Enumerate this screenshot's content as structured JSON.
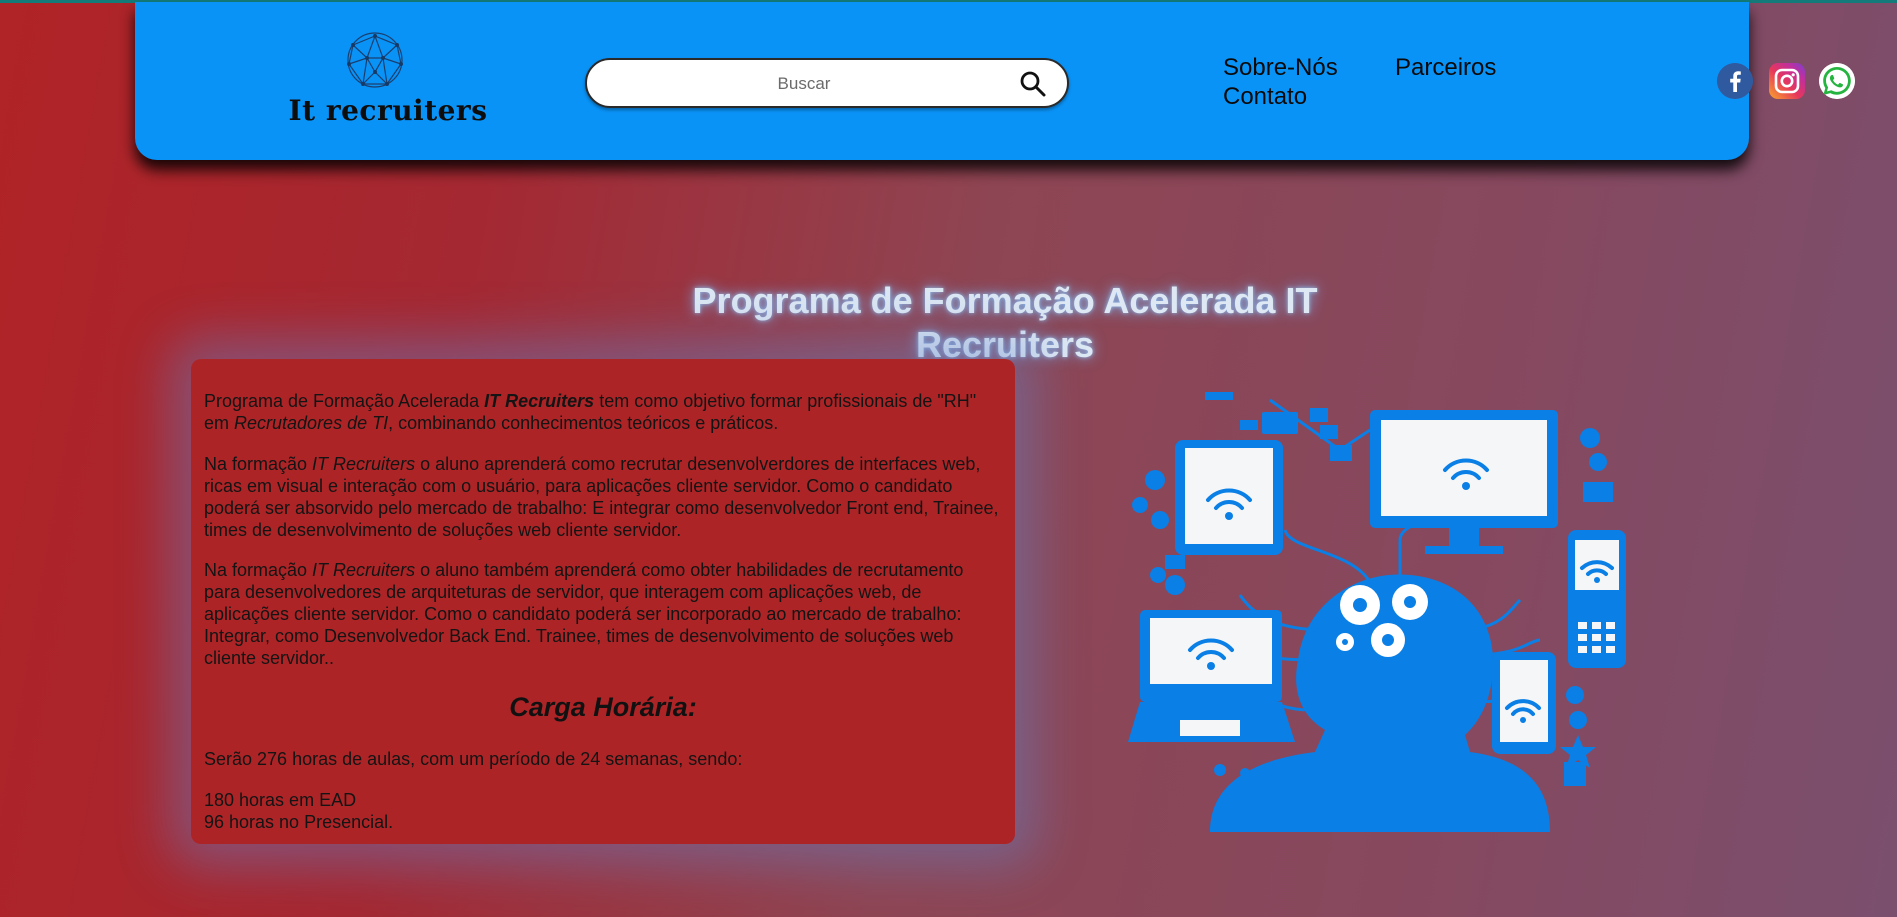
{
  "header": {
    "logo_text": "It recruiters",
    "search": {
      "placeholder": "Buscar"
    },
    "nav": {
      "about": "Sobre-Nós",
      "partners": "Parceiros",
      "contact": "Contato"
    },
    "social": [
      "facebook-icon",
      "instagram-icon",
      "whatsapp-icon"
    ]
  },
  "main": {
    "title": "Programa de Formação Acelerada IT Recruiters",
    "paragraph1": {
      "a": "Programa de Formação Acelerada ",
      "b": "IT Recruiters",
      "c": " tem como objetivo formar profissionais de \"RH\" em ",
      "d": "Recrutadores de TI",
      "e": ", combinando conhecimentos teóricos e práticos."
    },
    "paragraph2": {
      "a": "Na formação ",
      "b": "IT Recruiters",
      "c": " o aluno aprenderá como recrutar desenvolverdores de interfaces web, ricas em visual e interação com o usuário, para aplicações cliente servidor. Como o candidato poderá ser absorvido pelo mercado de trabalho: E integrar como desenvolvedor Front end, Trainee, times de desenvolvimento de soluções web cliente servidor."
    },
    "paragraph3": {
      "a": "Na formação ",
      "b": "IT Recruiters",
      "c": " o aluno também aprenderá como obter habilidades de recrutamento para desenvolvedores de arquiteturas de servidor, que interagem com aplicações web, de aplicações cliente servidor. Como o candidato poderá ser incorporado ao mercado de trabalho: Integrar, como Desenvolvedor Back End. Trainee, times de desenvolvimento de soluções web cliente servidor.."
    },
    "workload_title": "Carga Horária:",
    "workload_text": "Serão 276 horas de aulas, com um período de 24 semanas, sendo:",
    "workload_ead": "180 horas em EAD",
    "workload_presencial": "96 horas no Presencial."
  },
  "colors": {
    "header_bg": "#0a93f7",
    "card_bg": "#ad2427",
    "illustration": "#0a7fe6",
    "title_glow": "#78beff"
  }
}
